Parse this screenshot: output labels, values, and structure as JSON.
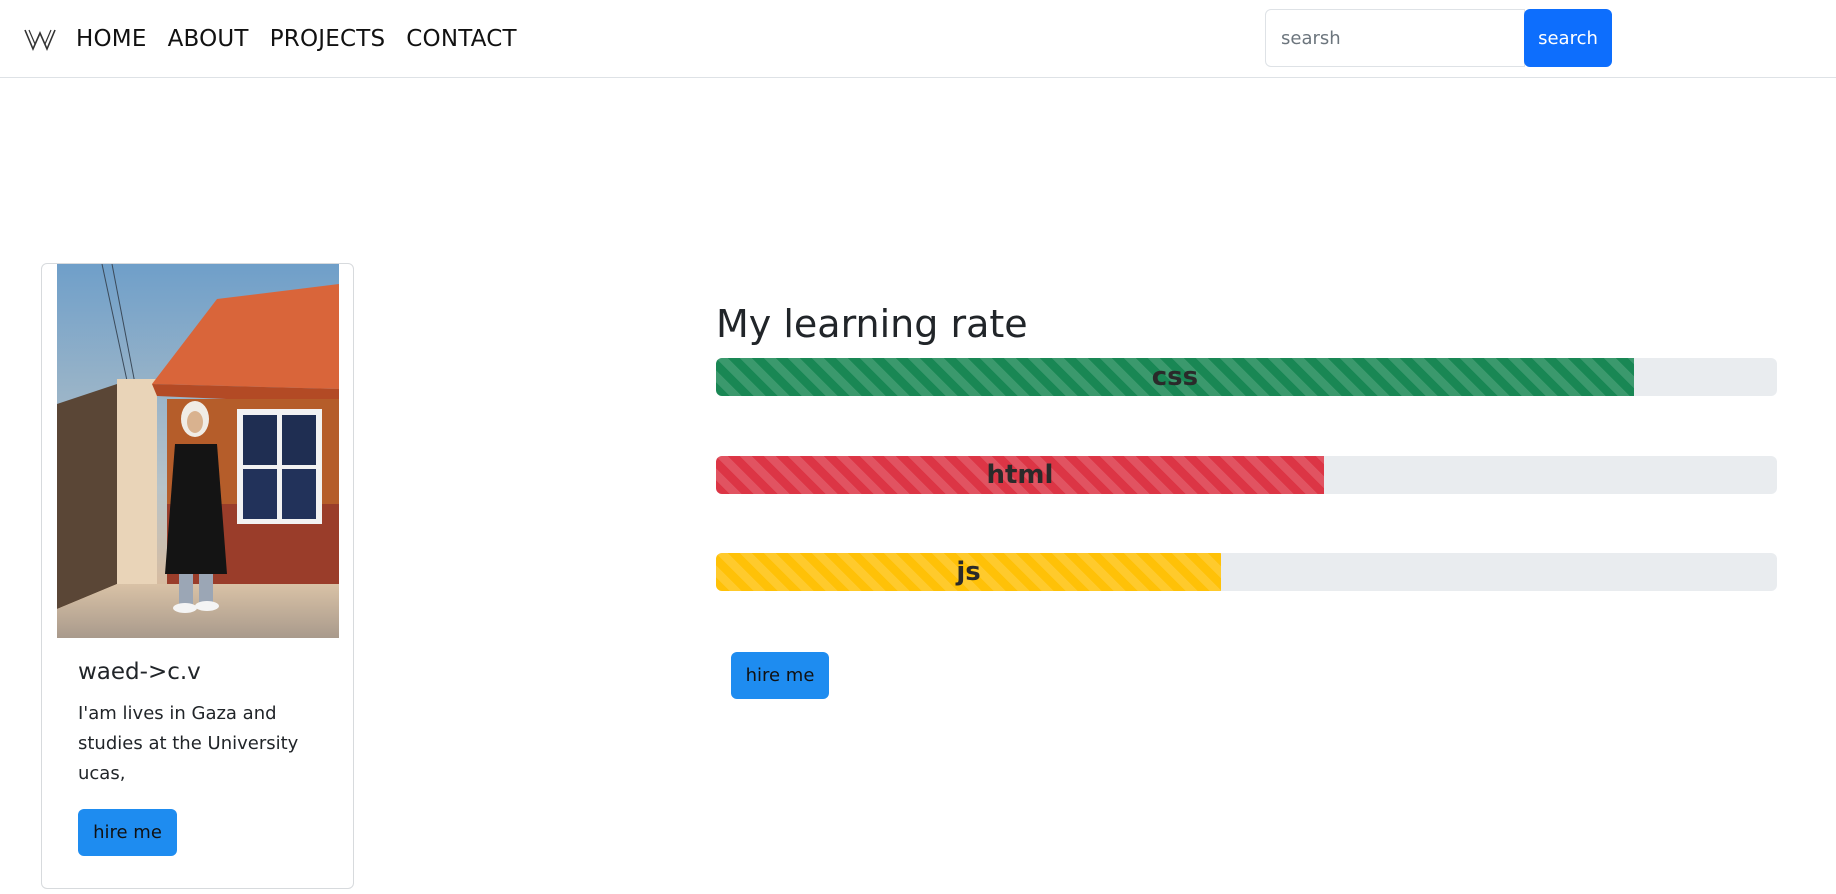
{
  "navbar": {
    "logo_icon": "w-logo-icon",
    "links": [
      "HOME",
      "ABOUT",
      "PROJECTS",
      "CONTACT"
    ],
    "search": {
      "placeholder": "searsh",
      "button_label": "search"
    }
  },
  "profile_card": {
    "title": "waed->c.v",
    "text": "I'am lives in Gaza and studies at the University ucas,",
    "button_label": "hire me"
  },
  "learning": {
    "title": "My learning rate",
    "bars": [
      {
        "label": "css",
        "percent": 86.5,
        "color": "#198754"
      },
      {
        "label": "html",
        "percent": 57.3,
        "color": "#dc3545"
      },
      {
        "label": "js",
        "percent": 47.6,
        "color": "#ffc107"
      }
    ],
    "button_label": "hire me"
  }
}
